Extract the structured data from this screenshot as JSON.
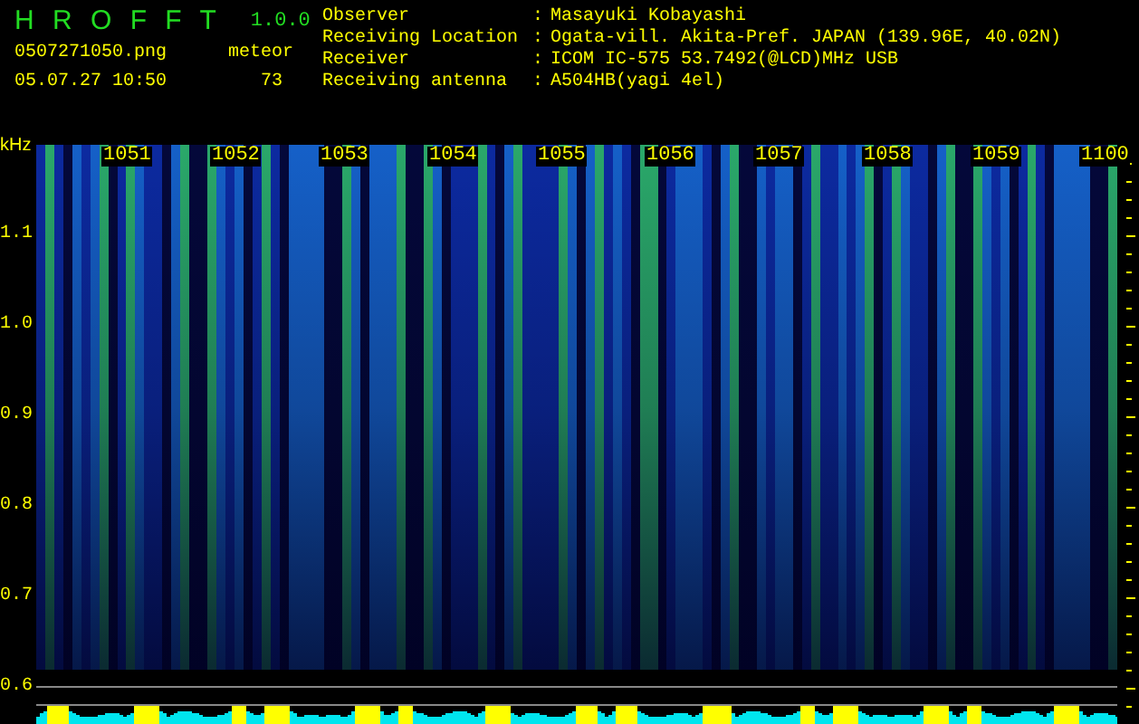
{
  "app": {
    "name": "H R O F F T",
    "version": "1.0.0"
  },
  "file": {
    "filename": "0507271050.png",
    "timestamp": "05.07.27 10:50",
    "count_label": "meteor",
    "count": "73"
  },
  "station": [
    {
      "label": "Observer",
      "separator": ":",
      "value": "Masayuki Kobayashi"
    },
    {
      "label": "Receiving Location",
      "separator": ":",
      "value": "Ogata-vill. Akita-Pref. JAPAN (139.96E, 40.02N)"
    },
    {
      "label": "Receiver",
      "separator": ":",
      "value": "ICOM IC-575 53.7492(@LCD)MHz USB"
    },
    {
      "label": "Receiving antenna",
      "separator": ":",
      "value": "A504HB(yagi 4el)"
    }
  ],
  "plot": {
    "unit": "kHz",
    "y_labels": [
      "1.1",
      "1.0",
      "0.9",
      "0.8",
      "0.7",
      "0.6"
    ],
    "time_labels": [
      "1051",
      "1052",
      "1053",
      "1054",
      "1055",
      "1056",
      "1057",
      "1058",
      "1059",
      "1100"
    ]
  }
}
